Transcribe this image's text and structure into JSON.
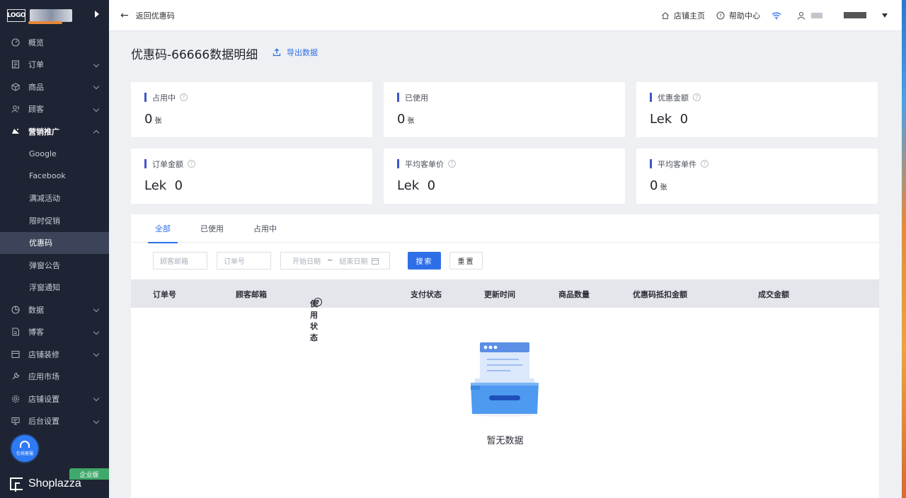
{
  "sidebar": {
    "logo_text": "LOGO",
    "items": [
      {
        "label": "概览",
        "icon": "dashboard-icon"
      },
      {
        "label": "订单",
        "icon": "order-icon"
      },
      {
        "label": "商品",
        "icon": "product-icon"
      },
      {
        "label": "顾客",
        "icon": "customer-icon"
      },
      {
        "label": "营销推广",
        "icon": "megaphone-icon"
      },
      {
        "label": "数据",
        "icon": "pie-chart-icon"
      },
      {
        "label": "博客",
        "icon": "blog-icon"
      },
      {
        "label": "店铺装修",
        "icon": "layout-icon"
      },
      {
        "label": "应用市场",
        "icon": "wrench-icon"
      },
      {
        "label": "店铺设置",
        "icon": "gear-icon"
      },
      {
        "label": "后台设置",
        "icon": "monitor-icon"
      }
    ],
    "marketing_sub": [
      "Google",
      "Facebook",
      "满减活动",
      "限时促销",
      "优惠码",
      "弹窗公告",
      "浮窗通知"
    ],
    "support_label": "在线客服",
    "edition": "企业版",
    "brand": "Shoplazza"
  },
  "header": {
    "back_label": "返回优惠码",
    "store_home": "店铺主页",
    "help_center": "帮助中心"
  },
  "page": {
    "title": "优惠码-66666数据明细",
    "export_label": "导出数据"
  },
  "stats": [
    {
      "label": "占用中",
      "value": "0",
      "unit": "张"
    },
    {
      "label": "已使用",
      "value": "0",
      "unit": "张"
    },
    {
      "label": "优惠金额",
      "value": "Lek  0",
      "unit": ""
    },
    {
      "label": "订单金额",
      "value": "Lek  0",
      "unit": ""
    },
    {
      "label": "平均客单价",
      "value": "Lek  0",
      "unit": ""
    },
    {
      "label": "平均客单件",
      "value": "0",
      "unit": "张"
    }
  ],
  "tabs": [
    "全部",
    "已使用",
    "占用中"
  ],
  "filters": {
    "email_placeholder": "顾客邮箱",
    "order_placeholder": "订单号",
    "start_date": "开始日期",
    "range_sep": "~",
    "end_date": "结束日期",
    "search_label": "搜索",
    "reset_label": "重置"
  },
  "table": {
    "columns": [
      "订单号",
      "顾客邮箱",
      "使用状态",
      "支付状态",
      "更新时间",
      "商品数量",
      "优惠码抵扣金额",
      "成交金额"
    ],
    "empty_text": "暂无数据"
  }
}
